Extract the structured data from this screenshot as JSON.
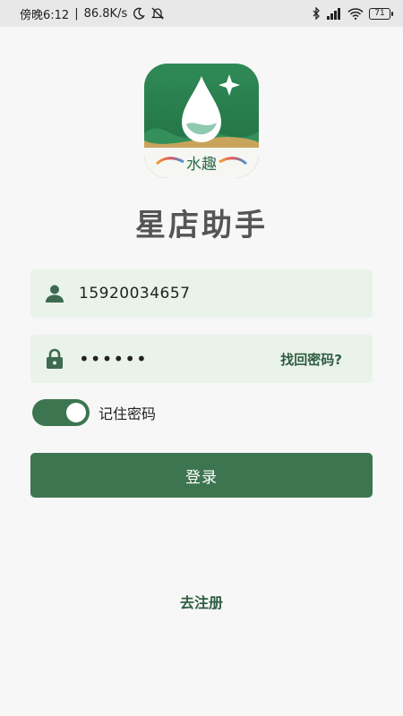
{
  "status_bar": {
    "time": "傍晚6:12",
    "speed": "86.8K/s",
    "battery": "71"
  },
  "logo": {
    "brand_text": "水趣"
  },
  "app": {
    "title": "星店助手"
  },
  "login_form": {
    "phone_value": "15920034657",
    "password_value": "••••••",
    "forgot_password": "找回密码?",
    "remember_label": "记住密码",
    "remember_checked": true,
    "login_button": "登录",
    "register_link": "去注册"
  },
  "colors": {
    "primary": "#3d7550",
    "field_bg": "#eaf3ea",
    "link": "#2f5d43"
  }
}
